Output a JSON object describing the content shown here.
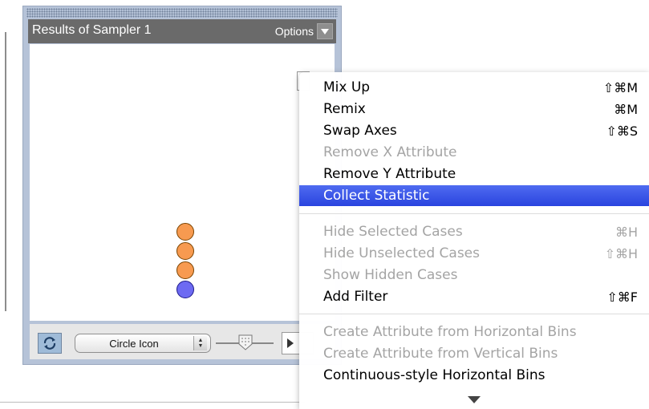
{
  "window": {
    "title": "Results of Sampler 1",
    "options_label": "Options",
    "icon_select_value": "Circle Icon"
  },
  "dots": [
    {
      "color": "#f79a50"
    },
    {
      "color": "#f79a50"
    },
    {
      "color": "#f79a50"
    },
    {
      "color": "#6d6af2"
    }
  ],
  "menu": {
    "items": [
      {
        "label": "Mix Up",
        "shortcut": "⇧⌘M",
        "disabled": false
      },
      {
        "label": "Remix",
        "shortcut": "⌘M",
        "disabled": false
      },
      {
        "label": "Swap Axes",
        "shortcut": "⇧⌘S",
        "disabled": false
      },
      {
        "label": "Remove X Attribute",
        "shortcut": "",
        "disabled": true
      },
      {
        "label": "Remove Y Attribute",
        "shortcut": "",
        "disabled": false
      },
      {
        "label": "Collect Statistic",
        "shortcut": "",
        "disabled": false,
        "highlighted": true
      },
      {
        "label": "Hide Selected Cases",
        "shortcut": "⌘H",
        "disabled": true
      },
      {
        "label": "Hide Unselected Cases",
        "shortcut": "⇧⌘H",
        "disabled": true
      },
      {
        "label": "Show Hidden Cases",
        "shortcut": "",
        "disabled": true
      },
      {
        "label": "Add Filter",
        "shortcut": "⇧⌘F",
        "disabled": false
      },
      {
        "label": "Create Attribute from Horizontal Bins",
        "shortcut": "",
        "disabled": true
      },
      {
        "label": "Create Attribute from Vertical Bins",
        "shortcut": "",
        "disabled": true
      },
      {
        "label": "Continuous-style Horizontal Bins",
        "shortcut": "",
        "disabled": false
      }
    ]
  },
  "colors": {
    "highlight": "#2a44df",
    "title_bar": "#6a6a6a",
    "window_frame": "#b6c3d8"
  }
}
